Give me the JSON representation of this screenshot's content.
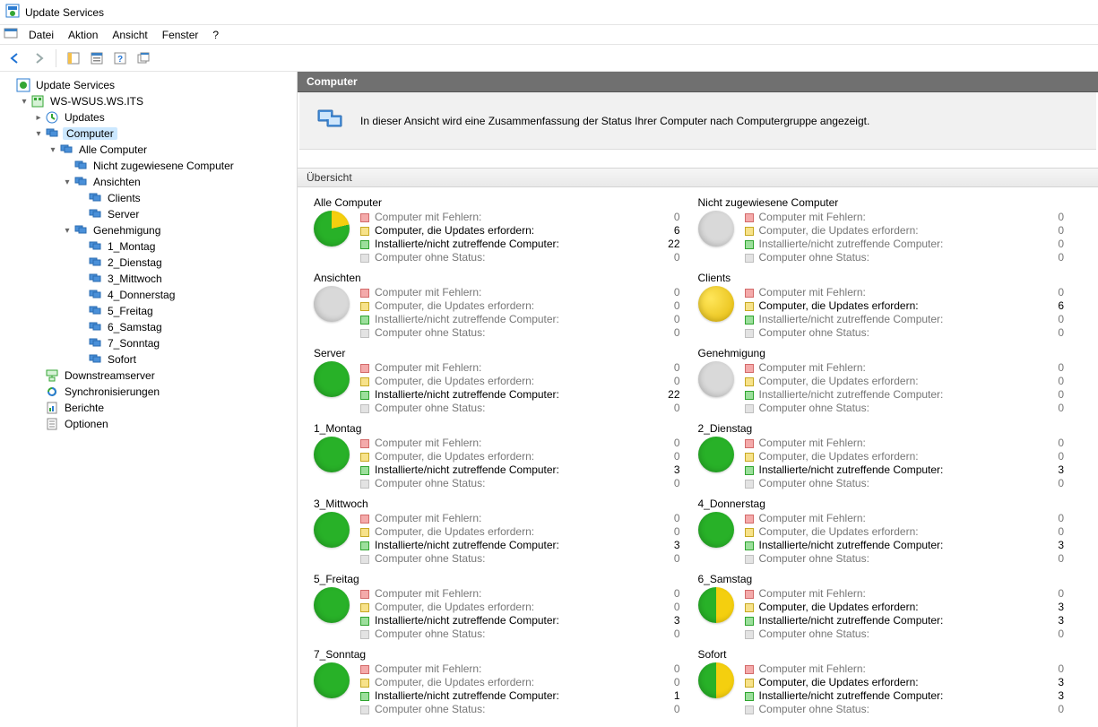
{
  "window": {
    "title": "Update Services"
  },
  "menu": {
    "items": [
      "Datei",
      "Aktion",
      "Ansicht",
      "Fenster",
      "?"
    ]
  },
  "tree": {
    "root": "Update Services",
    "server": "WS-WSUS.WS.ITS",
    "updates": "Updates",
    "computer": "Computer",
    "all_computers": "Alle Computer",
    "unassigned": "Nicht zugewiesene Computer",
    "views": "Ansichten",
    "clients": "Clients",
    "servers": "Server",
    "approval": "Genehmigung",
    "d1": "1_Montag",
    "d2": "2_Dienstag",
    "d3": "3_Mittwoch",
    "d4": "4_Donnerstag",
    "d5": "5_Freitag",
    "d6": "6_Samstag",
    "d7": "7_Sonntag",
    "d8": "Sofort",
    "downstream": "Downstreamserver",
    "syncs": "Synchronisierungen",
    "reports": "Berichte",
    "options": "Optionen"
  },
  "right": {
    "header": "Computer",
    "summary": "In dieser Ansicht wird eine Zusammenfassung der Status Ihrer Computer nach Computergruppe angezeigt.",
    "overview_label": "Übersicht",
    "row_labels": {
      "errors": "Computer mit Fehlern:",
      "need_updates": "Computer, die Updates erfordern:",
      "installed": "Installierte/nicht zutreffende Computer:",
      "no_status": "Computer ohne Status:"
    },
    "groups": [
      {
        "name": "Alle Computer",
        "pie": "mix-green-yellow-22",
        "errors": 0,
        "need": 6,
        "installed": 22,
        "none": 0,
        "bold": [
          "need",
          "installed"
        ]
      },
      {
        "name": "Nicht zugewiesene Computer",
        "pie": "gray",
        "errors": 0,
        "need": 0,
        "installed": 0,
        "none": 0,
        "bold": []
      },
      {
        "name": "Ansichten",
        "pie": "gray",
        "errors": 0,
        "need": 0,
        "installed": 0,
        "none": 0,
        "bold": []
      },
      {
        "name": "Clients",
        "pie": "yellow",
        "errors": 0,
        "need": 6,
        "installed": 0,
        "none": 0,
        "bold": [
          "need"
        ]
      },
      {
        "name": "Server",
        "pie": "green",
        "errors": 0,
        "need": 0,
        "installed": 22,
        "none": 0,
        "bold": [
          "installed"
        ]
      },
      {
        "name": "Genehmigung",
        "pie": "gray",
        "errors": 0,
        "need": 0,
        "installed": 0,
        "none": 0,
        "bold": []
      },
      {
        "name": "1_Montag",
        "pie": "green",
        "errors": 0,
        "need": 0,
        "installed": 3,
        "none": 0,
        "bold": [
          "installed"
        ]
      },
      {
        "name": "2_Dienstag",
        "pie": "green",
        "errors": 0,
        "need": 0,
        "installed": 3,
        "none": 0,
        "bold": [
          "installed"
        ]
      },
      {
        "name": "3_Mittwoch",
        "pie": "green",
        "errors": 0,
        "need": 0,
        "installed": 3,
        "none": 0,
        "bold": [
          "installed"
        ]
      },
      {
        "name": "4_Donnerstag",
        "pie": "green",
        "errors": 0,
        "need": 0,
        "installed": 3,
        "none": 0,
        "bold": [
          "installed"
        ]
      },
      {
        "name": "5_Freitag",
        "pie": "green",
        "errors": 0,
        "need": 0,
        "installed": 3,
        "none": 0,
        "bold": [
          "installed"
        ]
      },
      {
        "name": "6_Samstag",
        "pie": "mix-green-yellow-50",
        "errors": 0,
        "need": 3,
        "installed": 3,
        "none": 0,
        "bold": [
          "need",
          "installed"
        ]
      },
      {
        "name": "7_Sonntag",
        "pie": "green",
        "errors": 0,
        "need": 0,
        "installed": 1,
        "none": 0,
        "bold": [
          "installed"
        ]
      },
      {
        "name": "Sofort",
        "pie": "mix-green-yellow-50",
        "errors": 0,
        "need": 3,
        "installed": 3,
        "none": 0,
        "bold": [
          "need",
          "installed"
        ]
      }
    ]
  }
}
